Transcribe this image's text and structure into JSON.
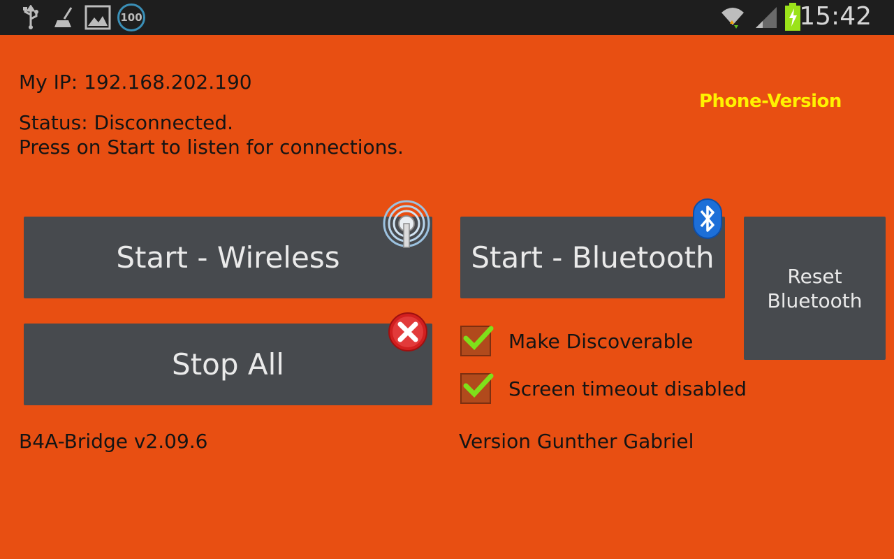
{
  "statusbar": {
    "time": "15:42",
    "notification_icons": [
      "usb-icon",
      "cleaner-icon",
      "image-icon",
      "battery-100-icon"
    ],
    "battery_badge": "100",
    "system_icons": [
      "wifi-icon",
      "signal-icon",
      "battery-charging-icon"
    ]
  },
  "info": {
    "ip": "My IP: 192.168.202.190",
    "status_line1": "Status: Disconnected.",
    "status_line2": "Press on Start to listen for connections.",
    "phone_version": "Phone-Version"
  },
  "buttons": {
    "start_wireless": "Start - Wireless",
    "start_bluetooth": "Start - Bluetooth",
    "stop_all": "Stop All",
    "reset_bluetooth": "Reset Bluetooth"
  },
  "checkboxes": [
    {
      "label": "Make Discoverable",
      "checked": true
    },
    {
      "label": "Screen timeout disabled",
      "checked": true
    }
  ],
  "footer": {
    "app_version": "B4A-Bridge v2.09.6",
    "author": "Version Gunther Gabriel"
  },
  "colors": {
    "background": "#e84f12",
    "button": "#474a4e",
    "highlight_text": "#fff200",
    "statusbar": "#1e1e1e"
  }
}
